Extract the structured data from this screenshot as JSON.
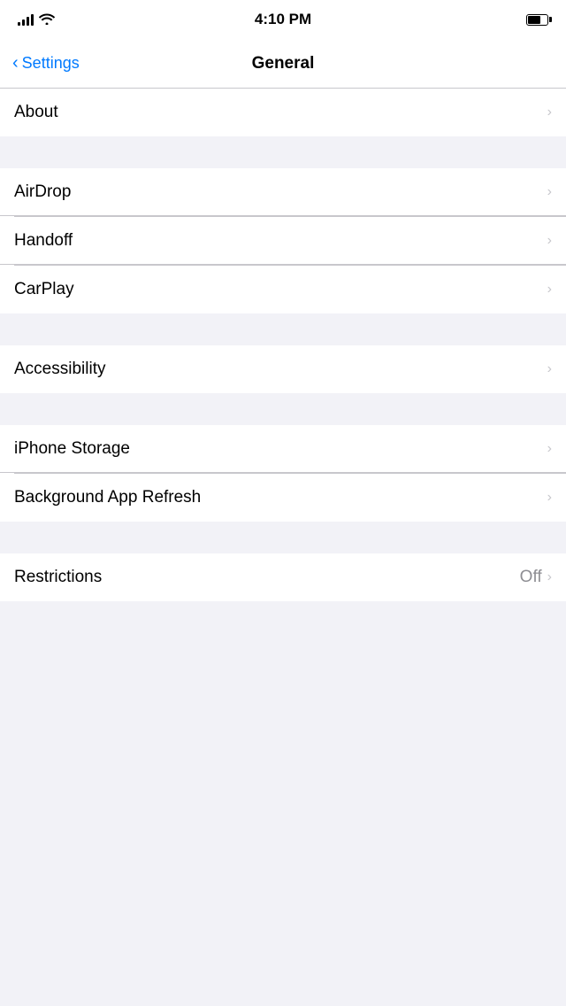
{
  "statusBar": {
    "time": "4:10 PM",
    "batteryPercent": 65
  },
  "navBar": {
    "backLabel": "Settings",
    "title": "General"
  },
  "sections": [
    {
      "id": "section-about",
      "items": [
        {
          "id": "about",
          "label": "About",
          "value": null
        }
      ]
    },
    {
      "id": "section-connectivity",
      "items": [
        {
          "id": "airdrop",
          "label": "AirDrop",
          "value": null
        },
        {
          "id": "handoff",
          "label": "Handoff",
          "value": null
        },
        {
          "id": "carplay",
          "label": "CarPlay",
          "value": null
        }
      ]
    },
    {
      "id": "section-accessibility",
      "items": [
        {
          "id": "accessibility",
          "label": "Accessibility",
          "value": null
        }
      ]
    },
    {
      "id": "section-storage",
      "items": [
        {
          "id": "iphone-storage",
          "label": "iPhone Storage",
          "value": null
        },
        {
          "id": "background-app-refresh",
          "label": "Background App Refresh",
          "value": null
        }
      ]
    },
    {
      "id": "section-restrictions",
      "items": [
        {
          "id": "restrictions",
          "label": "Restrictions",
          "value": "Off"
        }
      ]
    }
  ]
}
